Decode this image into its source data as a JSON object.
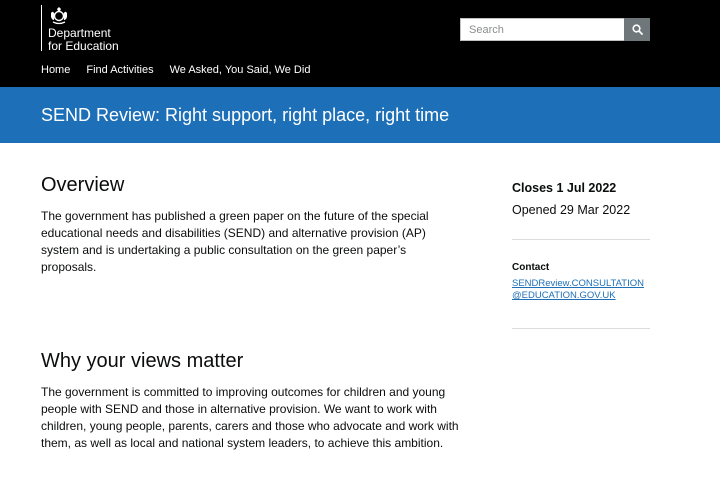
{
  "header": {
    "logo_line1": "Department",
    "logo_line2": "for Education",
    "crest_icon": "royal-crest-icon",
    "search_placeholder": "Search",
    "search_icon": "magnifier-icon"
  },
  "nav": {
    "items": [
      "Home",
      "Find Activities",
      "We Asked, You Said, We Did"
    ]
  },
  "banner": {
    "title": "SEND Review: Right support, right place, right time"
  },
  "main": {
    "overview_heading": "Overview",
    "overview_text": "The government has published a green paper on the future of the special educational needs and disabilities (SEND) and alternative provision (AP) system and is undertaking a public consultation on the green paper’s proposals.",
    "views_heading": "Why your views matter",
    "views_text": "The government is committed to improving outcomes for children and young people with SEND and those in alternative provision. We want to work with children, young people, parents, carers and those who advocate and work with them, as well as local and national system leaders, to achieve this ambition."
  },
  "aside": {
    "closes": "Closes 1 Jul 2022",
    "opened": "Opened 29 Mar 2022",
    "contact_label": "Contact",
    "contact_email": "SENDReview.CONSULTATION@EDUCATION.GOV.UK"
  },
  "colors": {
    "header_bg": "#000000",
    "banner_bg": "#1d70b8",
    "link": "#1d70b8",
    "search_button": "#6f777b"
  }
}
